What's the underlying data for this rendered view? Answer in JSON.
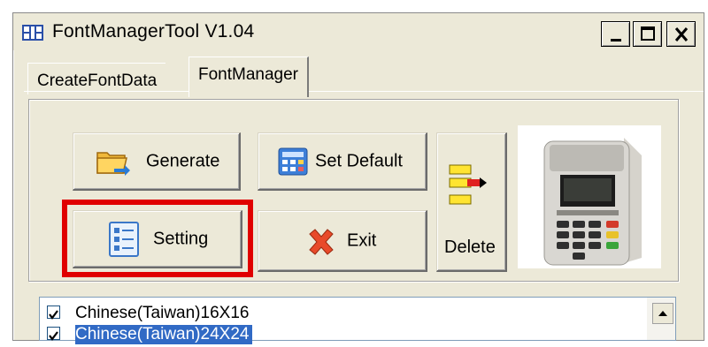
{
  "window": {
    "title": "FontManagerTool V1.04",
    "controls": {
      "minimize": "_",
      "maximize": "□",
      "close": "X"
    }
  },
  "tabs": [
    {
      "label": "CreateFontData",
      "active": false
    },
    {
      "label": "FontManager",
      "active": true
    }
  ],
  "buttons": {
    "generate": "Generate",
    "set_default": "Set Default",
    "setting": "Setting",
    "exit": "Exit",
    "delete": "Delete"
  },
  "font_list": [
    {
      "label": "Chinese(Taiwan)16X16",
      "checked": true,
      "selected": false
    },
    {
      "label": "Chinese(Taiwan)24X24",
      "checked": true,
      "selected": true
    }
  ],
  "colors": {
    "highlight_box": "#e00000",
    "selection": "#316ac5",
    "window_bg": "#ece9d8"
  },
  "icons": {
    "app": "app-logo-icon",
    "generate": "folder-arrow-icon",
    "set_default": "calculator-grid-icon",
    "setting": "checklist-icon",
    "exit": "red-x-icon",
    "delete": "yellow-blocks-arrow-icon"
  }
}
